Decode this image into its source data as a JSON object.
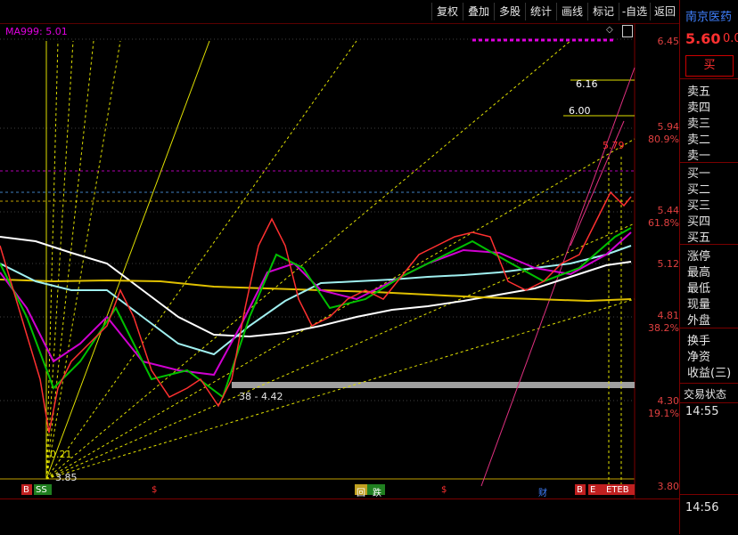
{
  "toolbar": {
    "buttons": [
      "复权",
      "叠加",
      "多股",
      "统计",
      "画线",
      "标记",
      "-自选",
      "返回"
    ]
  },
  "indicator": {
    "ma_label": "MA999: 5.01"
  },
  "price_axis": [
    {
      "price": "6.45"
    },
    {
      "price": "5.94",
      "pct": "80.9%"
    },
    {
      "price": "5.44",
      "pct": "61.8%"
    },
    {
      "price": "5.12"
    },
    {
      "price": "4.81",
      "pct": "38.2%"
    },
    {
      "price": "4.30",
      "pct": "19.1%"
    },
    {
      "price": "3.80"
    }
  ],
  "annotations": {
    "level_616": "6.16",
    "level_600": "6.00",
    "high_mark": "5.79",
    "range_label": "38 - 4.42",
    "low_mark": "3.85",
    "low_mark2": "0.21"
  },
  "events": [
    "B",
    "SS",
    "$",
    "回",
    "跌",
    "$",
    "财",
    "B",
    "E",
    "ETEB"
  ],
  "sidebar": {
    "stock_name": "南京医药",
    "price": "5.60",
    "change": "0.0",
    "buy_button": "买",
    "sell_levels": [
      "卖五",
      "卖四",
      "卖三",
      "卖二",
      "卖一"
    ],
    "buy_levels": [
      "买一",
      "买二",
      "买三",
      "买四",
      "买五"
    ],
    "stats": [
      "涨停",
      "最高",
      "最低",
      "现量",
      "外盘"
    ],
    "stats2": [
      "换手",
      "净资",
      "收益(三)"
    ],
    "trade_status_label": "交易状态",
    "time1": "14:55",
    "time2": "14:56"
  },
  "colors": {
    "price_up": "#ff3030",
    "price_down": "#00d4d4",
    "ma_white": "#ffffff",
    "ma_yellow": "#e0c000",
    "ma_magenta": "#e000e0",
    "ma_green": "#00c000",
    "ma_cyan": "#a0f0f0"
  }
}
